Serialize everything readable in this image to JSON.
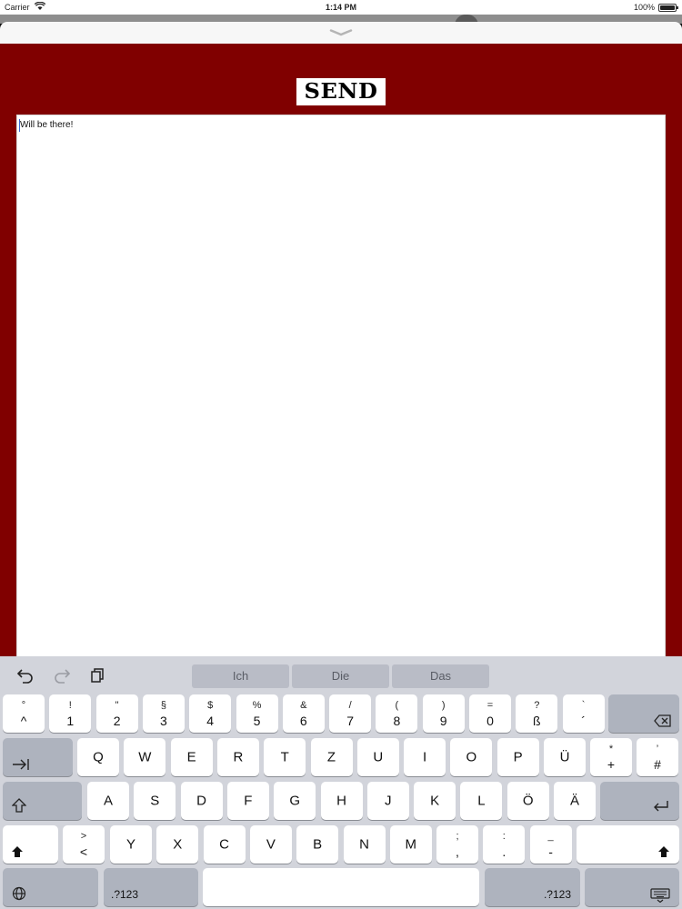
{
  "status_bar": {
    "carrier": "Carrier",
    "time": "1:14 PM",
    "battery": "100%"
  },
  "app": {
    "send_label": "SEND",
    "message_text": "Will be there!",
    "colors": {
      "background": "#800000",
      "send_button": "#ffffff",
      "text_area": "#ffffff"
    }
  },
  "keyboard": {
    "toolbar_icons": [
      "undo-icon",
      "redo-icon",
      "paste-icon"
    ],
    "suggestions": [
      "Ich",
      "Die",
      "Das"
    ],
    "row1": [
      {
        "top": "°",
        "bottom": "^"
      },
      {
        "top": "!",
        "bottom": "1"
      },
      {
        "top": "\"",
        "bottom": "2"
      },
      {
        "top": "§",
        "bottom": "3"
      },
      {
        "top": "$",
        "bottom": "4"
      },
      {
        "top": "%",
        "bottom": "5"
      },
      {
        "top": "&",
        "bottom": "6"
      },
      {
        "top": "/",
        "bottom": "7"
      },
      {
        "top": "(",
        "bottom": "8"
      },
      {
        "top": ")",
        "bottom": "9"
      },
      {
        "top": "=",
        "bottom": "0"
      },
      {
        "top": "?",
        "bottom": "ß"
      },
      {
        "top": "`",
        "bottom": "´"
      }
    ],
    "row2": [
      "Q",
      "W",
      "E",
      "R",
      "T",
      "Z",
      "U",
      "I",
      "O",
      "P",
      "Ü"
    ],
    "row2_extra": [
      {
        "top": "*",
        "bottom": "+"
      },
      {
        "top": "’",
        "bottom": "#"
      }
    ],
    "row3": [
      "A",
      "S",
      "D",
      "F",
      "G",
      "H",
      "J",
      "K",
      "L",
      "Ö",
      "Ä"
    ],
    "row4_first": {
      "top": ">",
      "bottom": "<"
    },
    "row4": [
      "Y",
      "X",
      "C",
      "V",
      "B",
      "N",
      "M"
    ],
    "row4_extra": [
      {
        "top": ";",
        "bottom": ","
      },
      {
        "top": ":",
        "bottom": "."
      },
      {
        "top": "_",
        "bottom": "-"
      }
    ],
    "numbers_label": ".?123",
    "icons": {
      "delete": "delete-icon",
      "tab": "tab-icon",
      "caps": "caps-lock-icon",
      "return": "return-icon",
      "shift": "shift-icon",
      "globe": "globe-icon",
      "dismiss": "keyboard-dismiss-icon"
    }
  }
}
